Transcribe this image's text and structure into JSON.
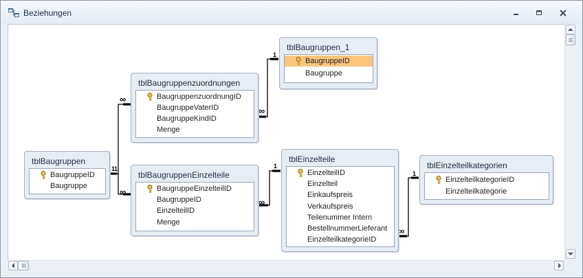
{
  "window": {
    "title": "Beziehungen",
    "icon": "relationships-icon",
    "buttons": [
      "minimize-icon",
      "restore-icon",
      "close-icon"
    ]
  },
  "tables": {
    "baugruppen": {
      "title": "tblBaugruppen",
      "fields": [
        {
          "name": "BaugruppeID",
          "key": true
        },
        {
          "name": "Baugruppe",
          "key": false
        }
      ]
    },
    "zuordnungen": {
      "title": "tblBaugruppenzuordnungen",
      "fields": [
        {
          "name": "BaugruppenzuordnungID",
          "key": true
        },
        {
          "name": "BaugruppeVaterID",
          "key": false
        },
        {
          "name": "BaugruppeKindID",
          "key": false
        },
        {
          "name": "Menge",
          "key": false
        }
      ]
    },
    "baugruppen_1": {
      "title": "tblBaugruppen_1",
      "fields": [
        {
          "name": "BaugruppeID",
          "key": true,
          "selected": true
        },
        {
          "name": "Baugruppe",
          "key": false
        }
      ]
    },
    "einzelteile_zuo": {
      "title": "tblBaugruppenEinzelteile",
      "fields": [
        {
          "name": "BaugruppeEinzelteilID",
          "key": true
        },
        {
          "name": "BaugruppeID",
          "key": false
        },
        {
          "name": "EinzelteilID",
          "key": false
        },
        {
          "name": "Menge",
          "key": false
        }
      ]
    },
    "einzelteile": {
      "title": "tblEinzelteile",
      "fields": [
        {
          "name": "EinzelteilID",
          "key": true
        },
        {
          "name": "Einzelteil",
          "key": false
        },
        {
          "name": "Einkaufspreis",
          "key": false
        },
        {
          "name": "Verkaufspreis",
          "key": false
        },
        {
          "name": "Teilenummer Intern",
          "key": false
        },
        {
          "name": "BestellnummerLieferant",
          "key": false
        },
        {
          "name": "EinzelteilkategorieID",
          "key": false
        }
      ]
    },
    "kategorien": {
      "title": "tblEinzelteilkategorien",
      "fields": [
        {
          "name": "EinzelteilkategorieID",
          "key": true
        },
        {
          "name": "Einzelteilkategorie",
          "key": false
        }
      ]
    }
  },
  "cardinality": {
    "one": "1",
    "many": "∞"
  },
  "scrollbars": {
    "vertical_icons": [
      "scroll-up-icon",
      "scroll-down-icon"
    ],
    "horizontal_icons": [
      "scroll-left-icon",
      "scroll-right-icon"
    ]
  }
}
